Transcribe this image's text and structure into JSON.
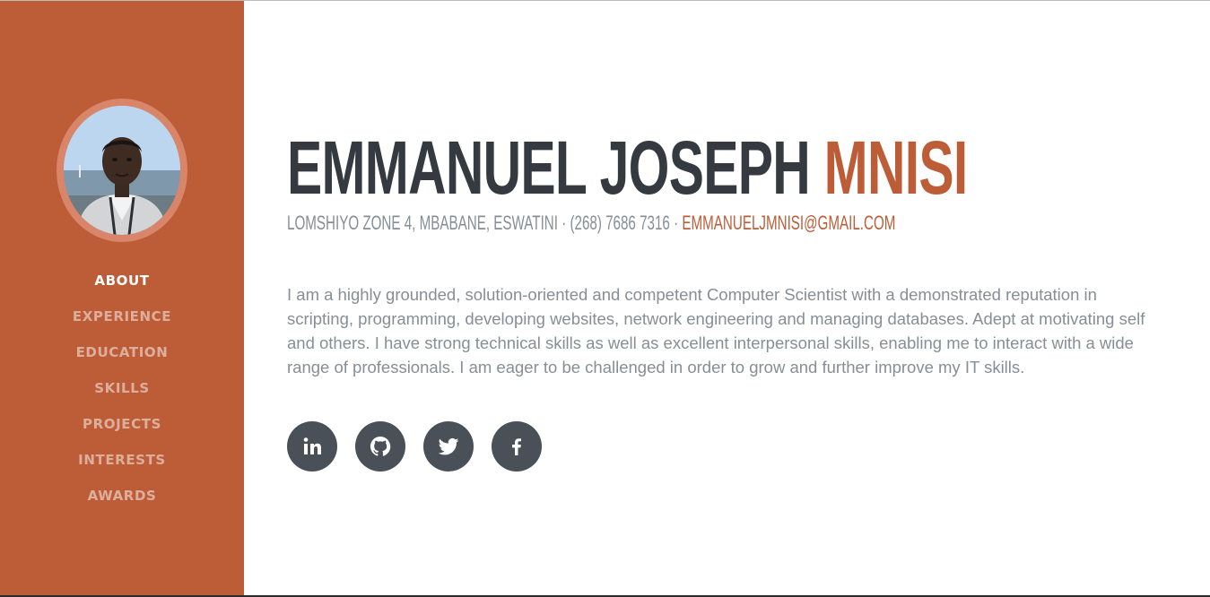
{
  "profile": {
    "first_names": "EMMANUEL JOSEPH",
    "last_name": "MNISI",
    "address": "LOMSHIYO ZONE 4, MBABANE, ESWATINI · (268) 7686 7316 · ",
    "email": "EMMANUELJMNISI@GMAIL.COM",
    "about": "I am a highly grounded, solution-oriented and competent Computer Scientist with a demonstrated reputation in scripting, programming, developing websites, network engineering and managing databases. Adept at motivating self and others. I have strong technical skills as well as excellent interpersonal skills, enabling me to interact with a wide range of professionals. I am eager to be challenged in order to grow and further improve my IT skills."
  },
  "sidebar": {
    "items": [
      {
        "label": "About",
        "active": true
      },
      {
        "label": "Experience"
      },
      {
        "label": "Education"
      },
      {
        "label": "Skills"
      },
      {
        "label": "Projects"
      },
      {
        "label": "Interests"
      },
      {
        "label": "Awards"
      }
    ]
  },
  "social": [
    {
      "icon": "linkedin-icon"
    },
    {
      "icon": "github-icon"
    },
    {
      "icon": "twitter-icon"
    },
    {
      "icon": "facebook-icon"
    }
  ],
  "colors": {
    "primary": "#bd5d38",
    "heading": "#343a40",
    "muted": "#868e96",
    "social_bg": "#495057"
  }
}
